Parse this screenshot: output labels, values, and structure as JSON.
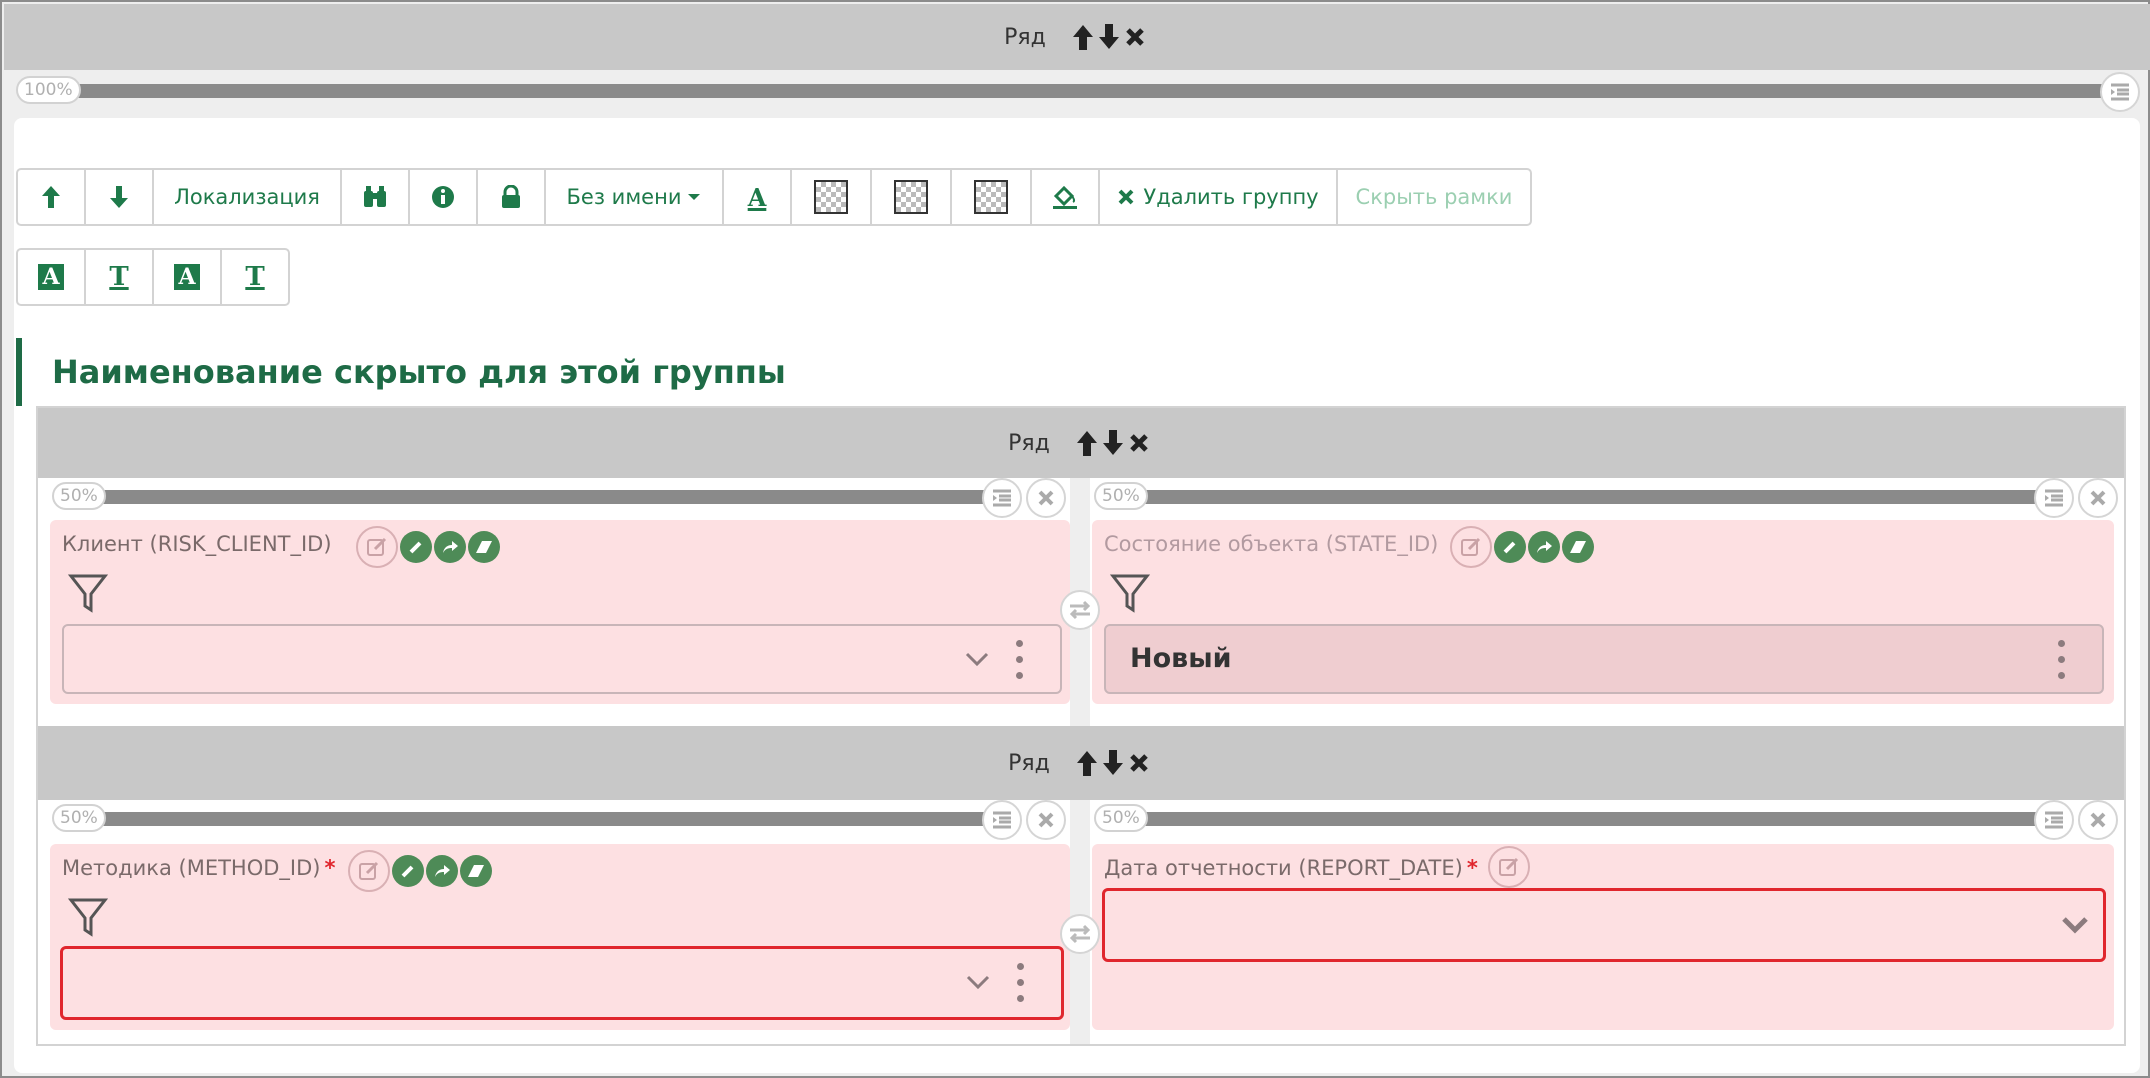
{
  "top_row": {
    "title": "Ряд"
  },
  "top_width": {
    "percent": "100%"
  },
  "toolbar": {
    "localization": "Локализация",
    "no_name": "Без имени",
    "delete_group": "Удалить группу",
    "hide_frames": "Скрыть рамки"
  },
  "group": {
    "title": "Наименование скрыто для этой группы"
  },
  "row1": {
    "title": "Ряд",
    "left": {
      "percent": "50%",
      "label": "Клиент (RISK_CLIENT_ID)",
      "value": ""
    },
    "right": {
      "percent": "50%",
      "label": "Состояние объекта (STATE_ID)",
      "value": "Новый"
    }
  },
  "row2": {
    "title": "Ряд",
    "left": {
      "percent": "50%",
      "label": "Методика (METHOD_ID)",
      "required": "*",
      "value": ""
    },
    "right": {
      "percent": "50%",
      "label": "Дата отчетности (REPORT_DATE)",
      "required": "*",
      "value": ""
    }
  },
  "colors": {
    "accent": "#1e7a4a",
    "field_bg": "#fde0e2",
    "error": "#e0262d",
    "row_header": "#c8c8c8"
  }
}
